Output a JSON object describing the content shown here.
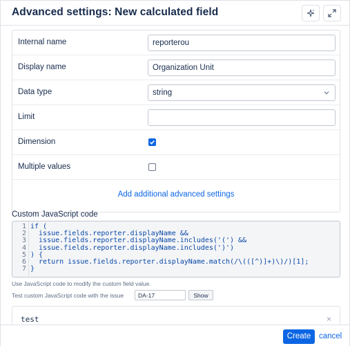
{
  "dialog": {
    "title": "Advanced settings: New calculated field"
  },
  "fields": {
    "internal_name": {
      "label": "Internal name",
      "value": "reporterou"
    },
    "display_name": {
      "label": "Display name",
      "value": "Organization Unit"
    },
    "data_type": {
      "label": "Data type",
      "value": "string"
    },
    "limit": {
      "label": "Limit",
      "value": ""
    },
    "dimension": {
      "label": "Dimension",
      "checked": true
    },
    "multiple_values": {
      "label": "Multiple values",
      "checked": false
    }
  },
  "add_settings_link": "Add additional advanced settings",
  "js": {
    "label": "Custom JavaScript code",
    "lines": [
      {
        "n": "1",
        "code": "if ("
      },
      {
        "n": "2",
        "code": "  issue.fields.reporter.displayName &&"
      },
      {
        "n": "3",
        "code": "  issue.fields.reporter.displayName.includes('(') &&"
      },
      {
        "n": "4",
        "code": "  issue.fields.reporter.displayName.includes(')')"
      },
      {
        "n": "5",
        "code": ") {"
      },
      {
        "n": "6",
        "code": "  return issue.fields.reporter.displayName.match(/\\(([^)]+)\\)/)[1];"
      },
      {
        "n": "7",
        "code": "}"
      }
    ],
    "helper": "Use JavaScript code to modify the custom field value.",
    "test_label": "Test custom JavaScript code with the issue",
    "test_issue": "DA-17",
    "show_label": "Show"
  },
  "result": {
    "value": "test",
    "clear_icon": "×"
  },
  "footer": {
    "create": "Create",
    "cancel": "cancel"
  },
  "colors": {
    "accent": "#0c66e4",
    "text": "#172b4d",
    "border": "#dfe1e6"
  }
}
